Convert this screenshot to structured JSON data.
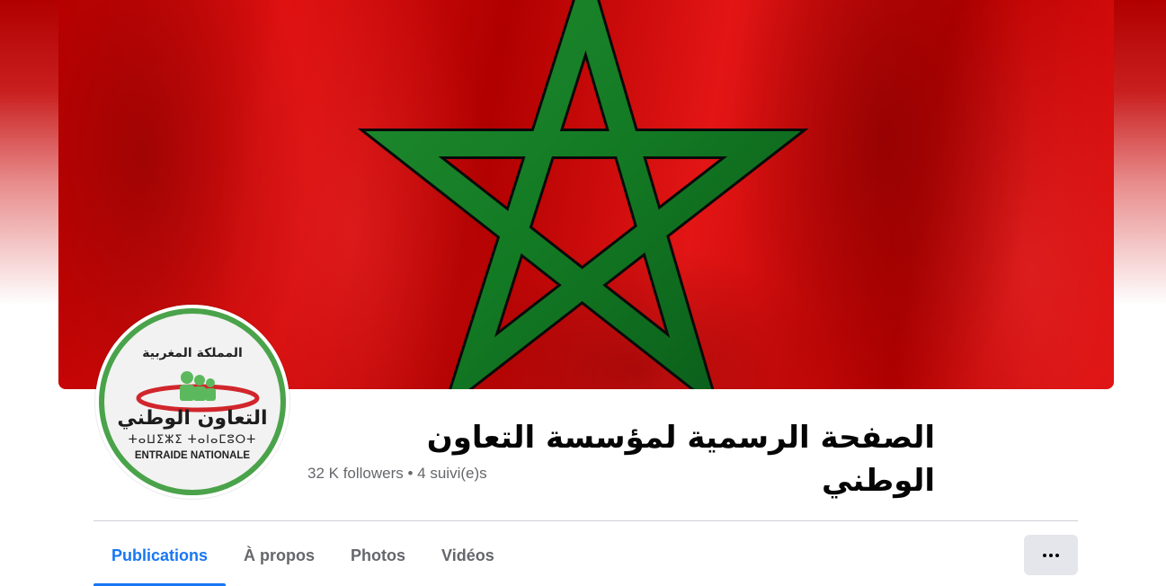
{
  "cover": {
    "description_icon": "moroccan-flag-star"
  },
  "profile": {
    "logo": {
      "arabic_top": "المملكة المغربية",
      "arabic_main": "التعاون الوطني",
      "tifinagh": "ⵜⴰⵡⵉⵣⵉ ⵜⴰⵏⴰⵎⵓⵔⵜ",
      "french": "ENTRAIDE NATIONALE"
    },
    "name": "الصفحة الرسمية لمؤسسة التعاون الوطني",
    "stats": "32 K followers • 4 suivi(e)s"
  },
  "tabs": [
    {
      "label": "Publications",
      "active": true
    },
    {
      "label": "À propos",
      "active": false
    },
    {
      "label": "Photos",
      "active": false
    },
    {
      "label": "Vidéos",
      "active": false
    }
  ],
  "more_button": {
    "icon": "more-horizontal-icon"
  },
  "colors": {
    "accent": "#1877f2",
    "flag_red": "#c1272d",
    "flag_green": "#006233",
    "logo_ring": "#4aa34a"
  }
}
